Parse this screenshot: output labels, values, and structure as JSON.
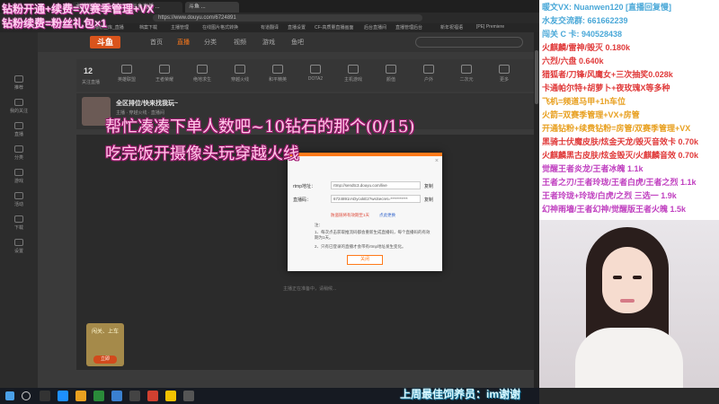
{
  "browser": {
    "tabs": [
      "主播粉丝 ...",
      "斗鱼直播 ...",
      "斗鱼 ..."
    ],
    "url": "https://www.douyu.com/6724891",
    "bookmarks": [
      "主播粉丝库_直播",
      "档案下载",
      "主播管理",
      "在线图片格式转换",
      "有道翻译",
      "直播设置",
      "CF-高质量直播画面",
      "后台直播间",
      "直播管理后台",
      "新年祝福语",
      "[PE] Premiere"
    ]
  },
  "leftbar": {
    "items": [
      "推荐",
      "我的关注",
      "直播",
      "分类",
      "游戏",
      "活动",
      "下载",
      "设置"
    ]
  },
  "topnav": {
    "logo": "斗鱼",
    "items": [
      "首页",
      "直播",
      "分类",
      "视频",
      "游戏",
      "鱼吧"
    ],
    "active_index": 1
  },
  "category_row": {
    "count": "12",
    "count_label": "关注直播",
    "items": [
      "英雄联盟",
      "王者荣耀",
      "绝地求生",
      "穿越火线",
      "和平精英",
      "DOTA2",
      "主机游戏",
      "颜值",
      "户外",
      "二次元",
      "更多"
    ]
  },
  "room": {
    "title": "全区排位/快来找我玩~",
    "subtitle": "主播 · 穿越火线 · 直播间"
  },
  "modal": {
    "close": "×",
    "rtmp_label": "rtmp地址：",
    "rtmp_value": "rtmp://sendtc3.douyu.com/live",
    "copy": "复制",
    "key_label": "直播码：",
    "key_value": "6724891rADycxkE2?wsSecret=***********",
    "copy2": "复制",
    "warn_link": "防盗链将有效期至1天",
    "change_link": "点此更换",
    "note_title": "注：",
    "note_1": "1、每次点击获取推流码都会重新生成直播码，每个直播码的有效期为1天。",
    "note_2": "2、只有已登录的直播才会带有rtmp地址发生变化。",
    "close_btn": "关闭"
  },
  "recording_text": "主播正在准备中，请稍候...",
  "side_card": {
    "title": "闯关、上车",
    "button": "立即"
  },
  "overlays": {
    "top_left_1": "钻粉开通+续费=双赛季管理+VX",
    "top_left_2": "钻粉续费=粉丝礼包×1",
    "big_1": "帮忙凑凑下单人数吧~10钻石的那个(0/15)",
    "big_2": "吃完饭开摄像头玩穿越火线",
    "bottom": "上周最佳饲养员：im谢谢"
  },
  "right_panel": {
    "lines": [
      {
        "text": "暖文VX: Nuanwen120 [直播回复慢]",
        "color": "#4aa8d8"
      },
      {
        "text": "水友交流群: 661662239",
        "color": "#4aa8d8"
      },
      {
        "text": "闯关 C 卡: 940528438",
        "color": "#4aa8d8"
      },
      {
        "text": "火麒麟/雷神/毁灭  0.180k",
        "color": "#e03a3a"
      },
      {
        "text": "六烈/六盘  0.640k",
        "color": "#e03a3a"
      },
      {
        "text": "猎狐者/刀锋/风鹰女+三次抽奖0.028k",
        "color": "#e03a3a"
      },
      {
        "text": "卡通帕尔特+胡萝卜+夜玫瑰X等多种",
        "color": "#e03a3a"
      },
      {
        "text": "飞机=频道马甲+1h车位",
        "color": "#e8a020"
      },
      {
        "text": "火箭=双赛季管理+VX+房管",
        "color": "#e8a020"
      },
      {
        "text": "开通钻粉+续费钻粉=房管/双赛季管理+VX",
        "color": "#e8a020"
      },
      {
        "text": "黑骑士伏魔皮肤/炫金天龙/毁灭音效卡 0.70k",
        "color": "#e03a3a"
      },
      {
        "text": "火麒麟黑古皮肤/炫金毁灭/火麒麟音效 0.70k",
        "color": "#e03a3a"
      },
      {
        "text": "觉醒王者炎龙/王者冰魄 1.1k",
        "color": "#c040c0"
      },
      {
        "text": "王者之刃/王者玲珑/王者白虎/王者之烈 1.1k",
        "color": "#c040c0"
      },
      {
        "text": "王者玲珑+玲珑/白虎/之烈 三选一  1.9k",
        "color": "#c040c0"
      },
      {
        "text": "幻神雨墙/王者幻神/觉醒版王者火魄  1.5k",
        "color": "#c040c0"
      }
    ]
  }
}
